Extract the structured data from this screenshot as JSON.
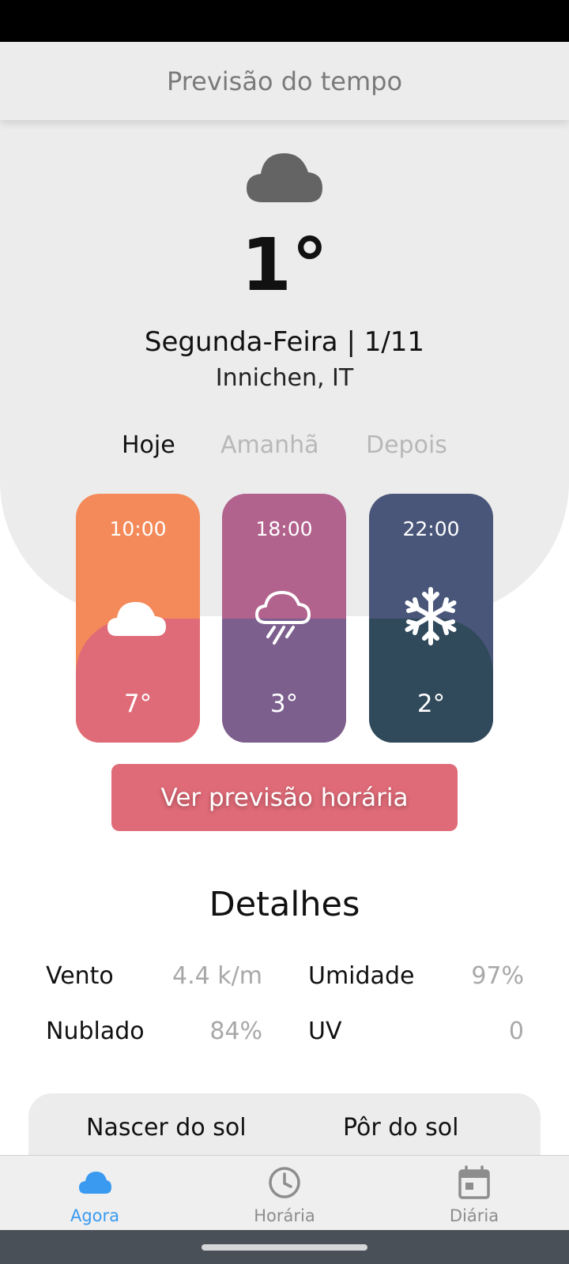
{
  "app": {
    "title": "Previsão do tempo"
  },
  "current": {
    "icon": "cloud-icon",
    "temperature": "1°",
    "date": "Segunda-Feira | 1/11",
    "location": "Innichen, IT"
  },
  "tabs": [
    {
      "label": "Hoje",
      "active": true
    },
    {
      "label": "Amanhã",
      "active": false
    },
    {
      "label": "Depois",
      "active": false
    }
  ],
  "hourly": [
    {
      "time": "10:00",
      "icon": "cloud-icon",
      "temp": "7°",
      "color_top": "#f48a5a",
      "color_bottom": "#e06b78"
    },
    {
      "time": "18:00",
      "icon": "rain-cloud-icon",
      "temp": "3°",
      "color_top": "#b1628d",
      "color_bottom": "#7c5f8d"
    },
    {
      "time": "22:00",
      "icon": "snowflake-icon",
      "temp": "2°",
      "color_top": "#495679",
      "color_bottom": "#30495b"
    }
  ],
  "forecast_button": "Ver previsão horária",
  "details": {
    "title": "Detalhes",
    "items": [
      {
        "label": "Vento",
        "value": "4.4 k/m"
      },
      {
        "label": "Umidade",
        "value": "97%"
      },
      {
        "label": "Nublado",
        "value": "84%"
      },
      {
        "label": "UV",
        "value": "0"
      }
    ]
  },
  "sun": {
    "sunrise_label": "Nascer do sol",
    "sunset_label": "Pôr do sol"
  },
  "bottom_nav": [
    {
      "label": "Agora",
      "icon": "cloud-icon",
      "active": true
    },
    {
      "label": "Horária",
      "icon": "clock-icon",
      "active": false
    },
    {
      "label": "Diária",
      "icon": "calendar-icon",
      "active": false
    }
  ],
  "colors": {
    "accent": "#e06b78",
    "nav_active": "#3a9af0",
    "surface": "#ececec"
  }
}
